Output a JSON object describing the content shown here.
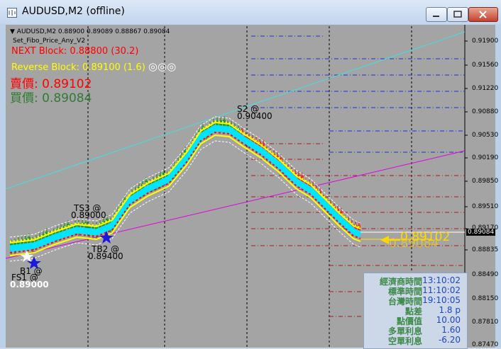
{
  "window": {
    "title": "AUDUSD,M2 (offline)"
  },
  "chart": {
    "header_line": "AUDUSD,M2  0.88900 0.89089 0.88867 0.89084",
    "indicator_name": "Set_Fibo_Price_Any_V2",
    "next_block": "NEXT Block: 0.88800 (30.2)",
    "reverse_block": "Reverse Block: 0.89100 (1.6)",
    "reverse_symbols": "◎◎◎",
    "sell_label": "賣價:",
    "sell_price": "0.89102",
    "buy_label": "買價:",
    "buy_price": "0.89084",
    "price_axis": [
      "0.91900",
      "0.91560",
      "0.91220",
      "0.90880",
      "0.90530",
      "0.90190",
      "0.89850",
      "0.89510",
      "0.89170",
      "0.88835",
      "0.88490",
      "0.88150",
      "0.87810",
      "0.87470"
    ],
    "current_price_tag": "0.89084",
    "annotations": {
      "s2": "S2 @",
      "s2_price": "0.90400",
      "ts3": "TS3 @",
      "ts3_price": "0.89000",
      "tb2": "TB2 @",
      "tb2_price": "0.89400",
      "b1": "B1 @",
      "fs1": "FS1 @",
      "fs1_price": "0.89000",
      "arrow_price": "0.89102",
      "arrow_price2": "0.89084"
    },
    "colors": {
      "background": "#a4a4a4",
      "next_block": "#ff0000",
      "reverse_block": "#ffff00",
      "sell": "#ff0000",
      "buy": "#2e7d32",
      "trend_upper": "#40e0e0",
      "trend_lower": "#e000e0",
      "band": "#ffff00",
      "band_core": "#00e5ff"
    }
  },
  "info": {
    "rows": [
      {
        "label": "經濟商時間",
        "value": "13:10:02"
      },
      {
        "label": "標準時間",
        "value": "11:10:02"
      },
      {
        "label": "台灣時間",
        "value": "19:10:05"
      },
      {
        "label": "點差",
        "value": "1.8 p"
      },
      {
        "label": "點價值",
        "value": "10.00"
      },
      {
        "label": "多單利息",
        "value": "1.60"
      },
      {
        "label": "空單利息",
        "value": "-6.20"
      }
    ]
  }
}
